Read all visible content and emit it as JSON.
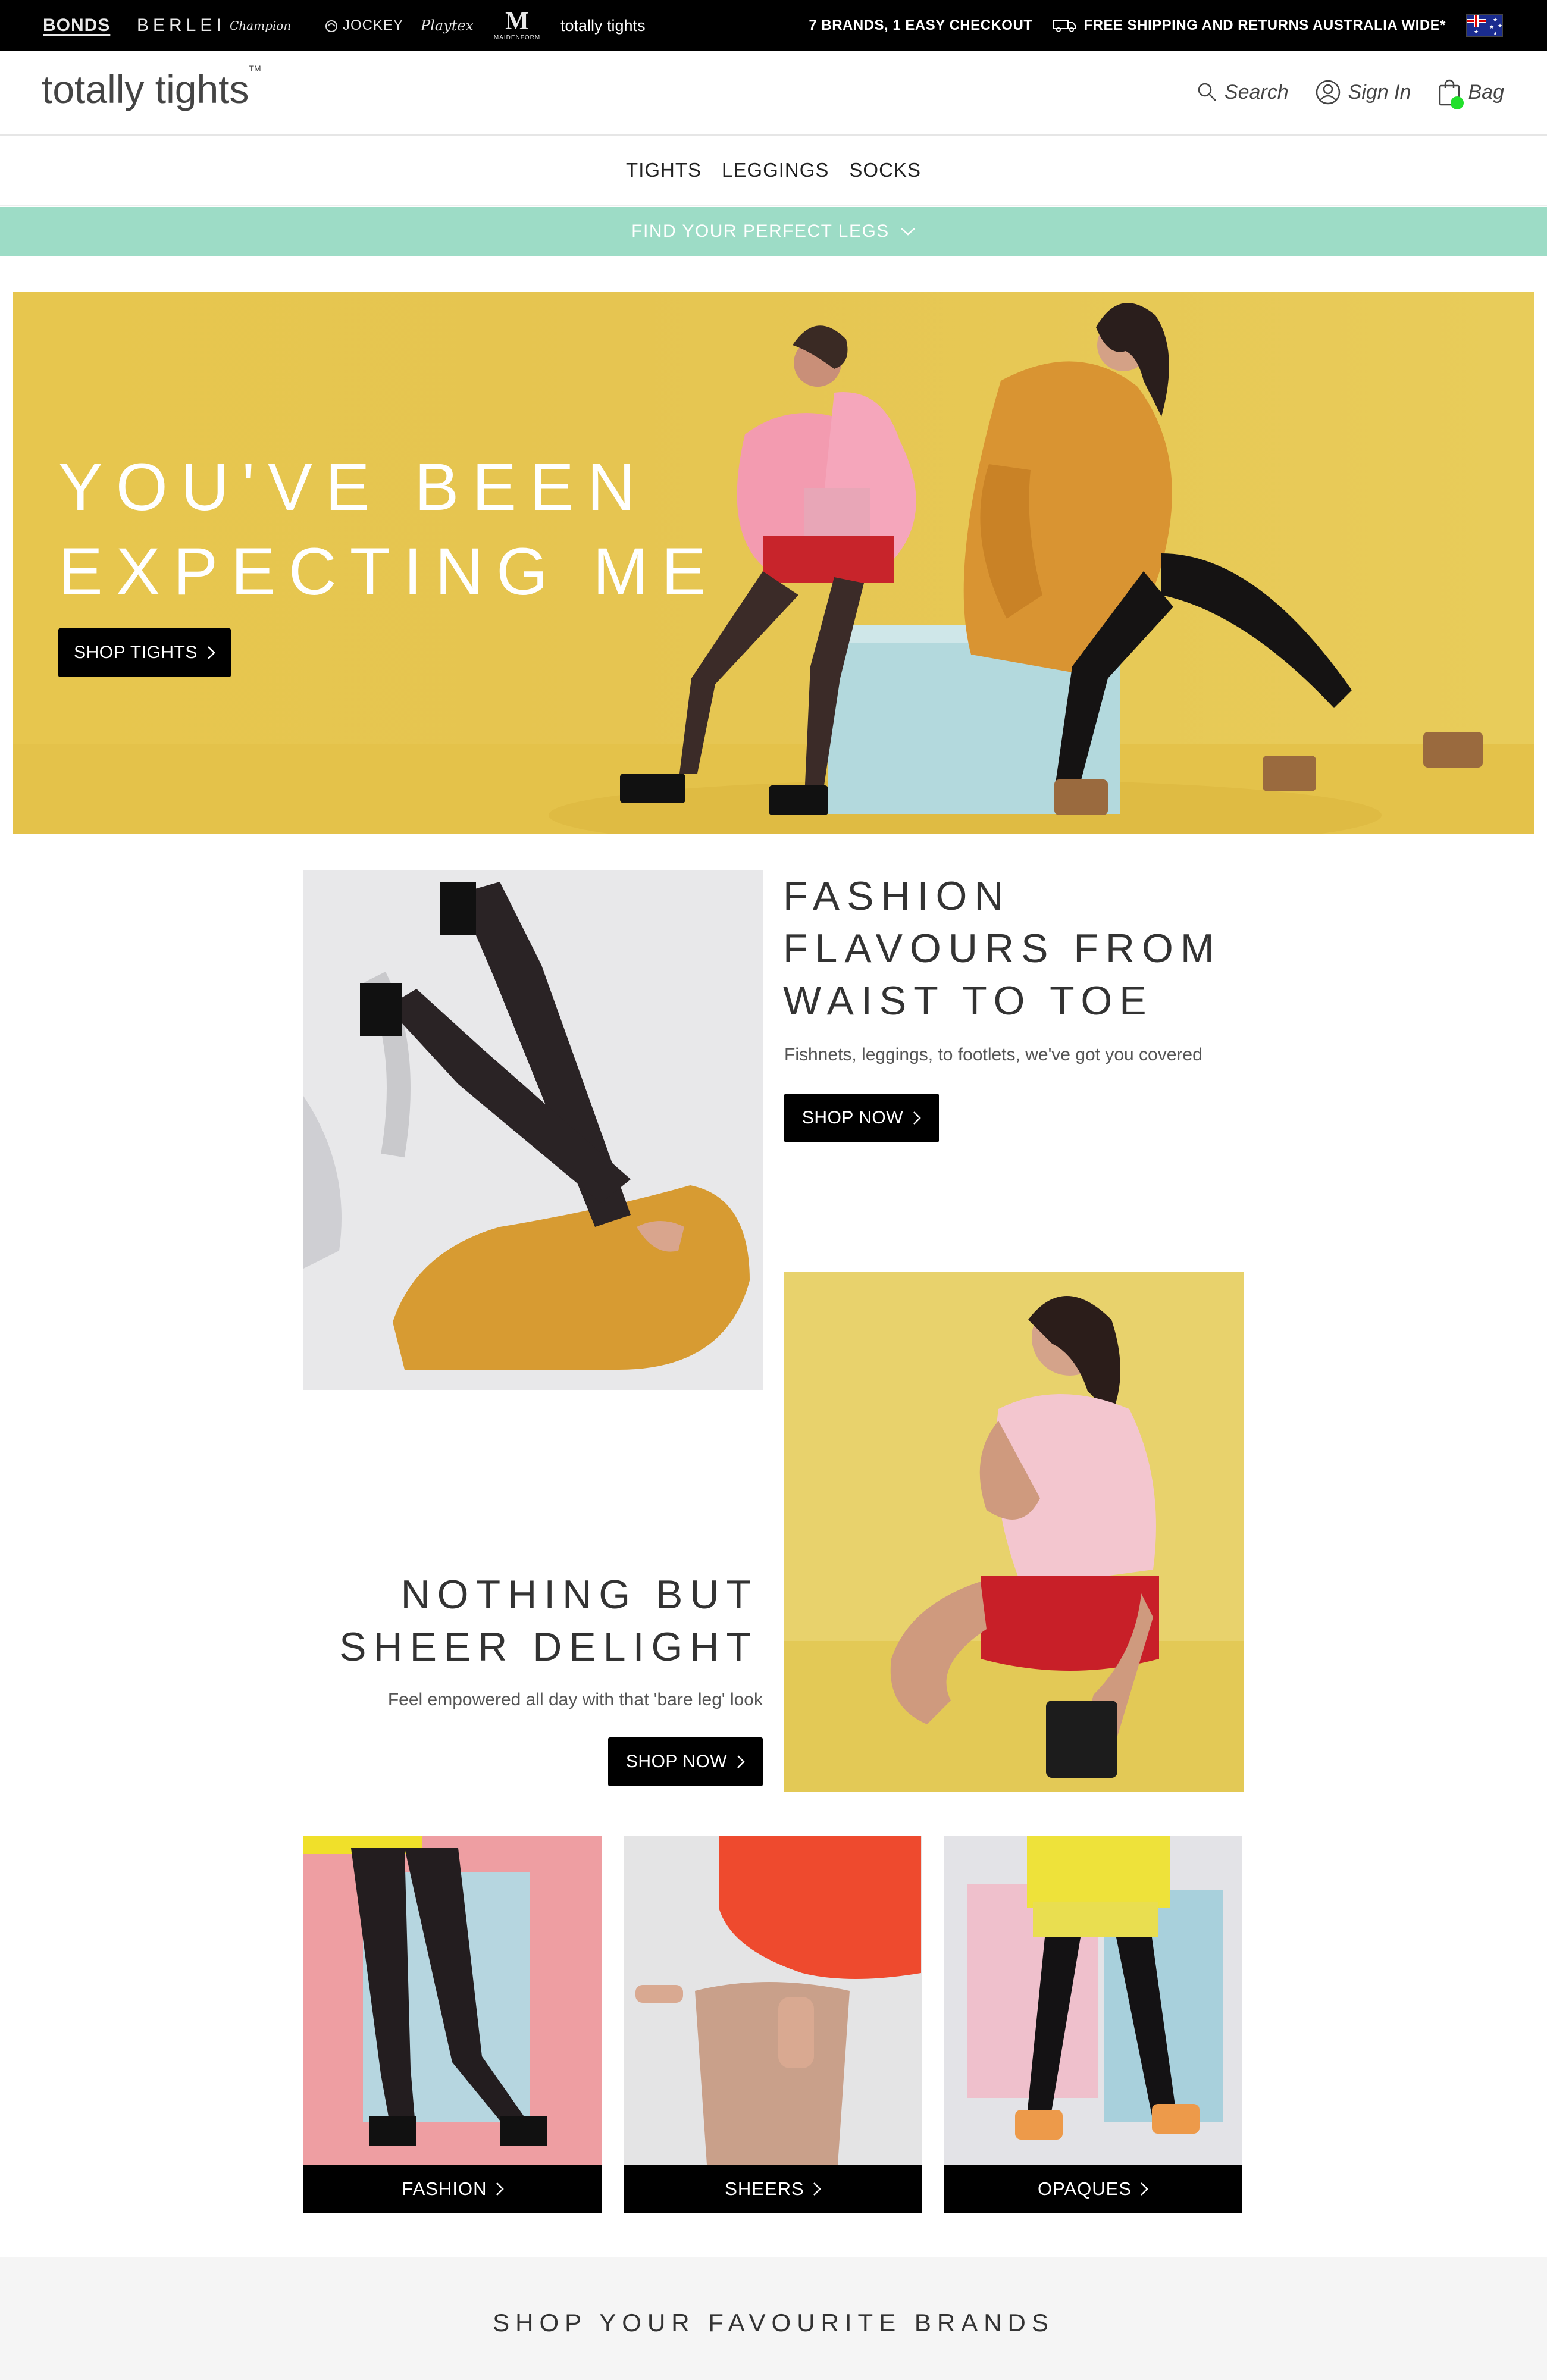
{
  "topbar": {
    "brands": [
      "BONDS",
      "BERLEI",
      "Champion",
      "JOCKEY",
      "Playtex",
      "M",
      "MAIDENFORM",
      "totally tights"
    ],
    "promo": "7 BRANDS, 1 EASY CHECKOUT",
    "shipping": "FREE SHIPPING AND RETURNS AUSTRALIA WIDE*",
    "shipping_icon": "truck-icon",
    "region_icon": "australia-flag-icon"
  },
  "header": {
    "logo": "totally tights",
    "logo_tm": "TM",
    "search": "Search",
    "sign_in": "Sign In",
    "bag": "Bag"
  },
  "nav": {
    "items": [
      "TIGHTS",
      "LEGGINGS",
      "SOCKS"
    ]
  },
  "finder": {
    "label": "FIND YOUR PERFECT LEGS",
    "icon": "chevron-down-icon",
    "color": "#9ddcc6"
  },
  "hero": {
    "title_line1": "YOU'VE BEEN",
    "title_line2": "EXPECTING ME",
    "button": "SHOP TIGHTS",
    "background": "#e7c64e"
  },
  "fashion": {
    "title_line1": "FASHION",
    "title_line2": "FLAVOURS FROM",
    "title_line3": "WAIST TO TOE",
    "subtitle": "Fishnets, leggings, to footlets, we've got you covered",
    "button": "SHOP NOW"
  },
  "sheer": {
    "title_line1": "NOTHING BUT",
    "title_line2": "SHEER DELIGHT",
    "subtitle": "Feel empowered all day with that 'bare leg' look",
    "button": "SHOP NOW"
  },
  "categories": [
    {
      "label": "FASHION"
    },
    {
      "label": "SHEERS"
    },
    {
      "label": "OPAQUES"
    }
  ],
  "brands_section": {
    "title": "SHOP YOUR FAVOURITE BRANDS"
  }
}
